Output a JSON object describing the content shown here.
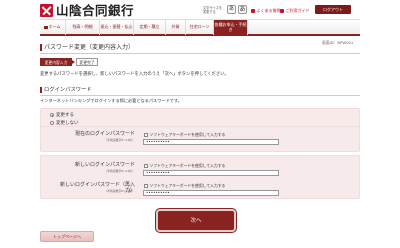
{
  "header": {
    "bank_name": "山陰合同銀行",
    "font_size_label": "文字サイズを変更する",
    "font_small": "あ",
    "font_large": "あ",
    "faq": "よくある質問",
    "help": "ご利用ガイド",
    "logout": "ログアウト"
  },
  "nav": {
    "items": [
      {
        "label": "ホーム"
      },
      {
        "label": "残高・明細"
      },
      {
        "label": "振込・振替・払込"
      },
      {
        "label": "定期・積立"
      },
      {
        "label": "外貨"
      },
      {
        "label": "住宅ローン"
      },
      {
        "label": "各種お申込・手続き"
      }
    ]
  },
  "page": {
    "id": "画面ID：BPW001",
    "title": "パスワード変更（変更内容入力）",
    "steps": [
      "変更内容入力",
      "変更完了"
    ],
    "description": "変更するパスワードを選択し、新しいパスワードを入力のうえ「次へ」ボタンを押してください。"
  },
  "section": {
    "title": "ログインパスワード",
    "subtitle": "インターネットバンキングでログインする際に必要となるパスワードです。",
    "radio_change": "変更する",
    "radio_nochange": "変更しない",
    "software_kb": "ソフトウェアキーボードを使用して入力する",
    "current_label": "現在のログインパスワード",
    "current_note": "（半角英数字6〜12桁）",
    "current_value": "••••••••••",
    "new_label": "新しいログインパスワード",
    "new_note": "（半角英数字6〜12桁）",
    "new_value": "••••••••••",
    "confirm_label": "新しいログインパスワード（再入力）",
    "confirm_note": "（半角英数字6〜12桁）",
    "confirm_value": "••••••••••"
  },
  "buttons": {
    "next": "次へ",
    "back": "トップページへ"
  },
  "colors": {
    "brand": "#8b2222",
    "accent": "#c8102e",
    "panel": "#f7eaea"
  }
}
